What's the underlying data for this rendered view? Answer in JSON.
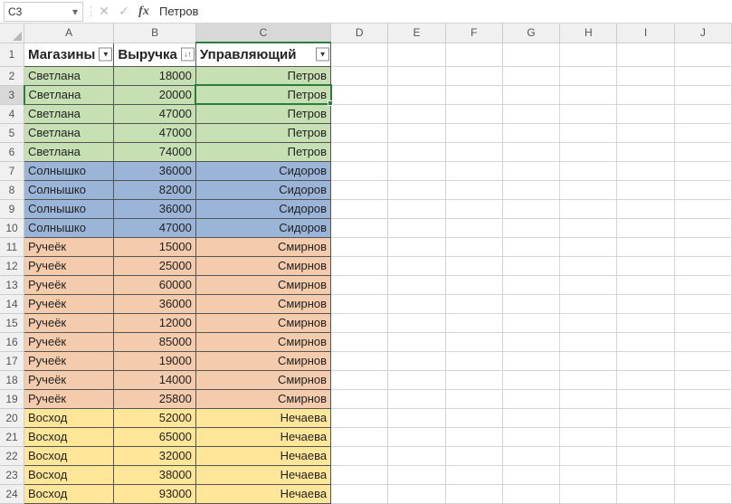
{
  "formula_bar": {
    "cell_ref": "C3",
    "cancel": "✕",
    "confirm": "✓",
    "fx": "fx",
    "value": "Петров"
  },
  "columns": [
    "A",
    "B",
    "C",
    "D",
    "E",
    "F",
    "G",
    "H",
    "I",
    "J"
  ],
  "active_col": "C",
  "active_row": 3,
  "header": {
    "A": "Магазины",
    "B": "Выручка",
    "C": "Управляющий"
  },
  "filter_glyph": {
    "A": "▼",
    "B": "↓↑",
    "C": "▼"
  },
  "rows": [
    {
      "n": 2,
      "store": "Светлана",
      "rev": 18000,
      "mgr": "Петров",
      "cls": "green"
    },
    {
      "n": 3,
      "store": "Светлана",
      "rev": 20000,
      "mgr": "Петров",
      "cls": "green"
    },
    {
      "n": 4,
      "store": "Светлана",
      "rev": 47000,
      "mgr": "Петров",
      "cls": "green"
    },
    {
      "n": 5,
      "store": "Светлана",
      "rev": 47000,
      "mgr": "Петров",
      "cls": "green"
    },
    {
      "n": 6,
      "store": "Светлана",
      "rev": 74000,
      "mgr": "Петров",
      "cls": "green"
    },
    {
      "n": 7,
      "store": "Солнышко",
      "rev": 36000,
      "mgr": "Сидоров",
      "cls": "blue"
    },
    {
      "n": 8,
      "store": "Солнышко",
      "rev": 82000,
      "mgr": "Сидоров",
      "cls": "blue"
    },
    {
      "n": 9,
      "store": "Солнышко",
      "rev": 36000,
      "mgr": "Сидоров",
      "cls": "blue"
    },
    {
      "n": 10,
      "store": "Солнышко",
      "rev": 47000,
      "mgr": "Сидоров",
      "cls": "blue"
    },
    {
      "n": 11,
      "store": "Ручеёк",
      "rev": 15000,
      "mgr": "Смирнов",
      "cls": "peach"
    },
    {
      "n": 12,
      "store": "Ручеёк",
      "rev": 25000,
      "mgr": "Смирнов",
      "cls": "peach"
    },
    {
      "n": 13,
      "store": "Ручеёк",
      "rev": 60000,
      "mgr": "Смирнов",
      "cls": "peach"
    },
    {
      "n": 14,
      "store": "Ручеёк",
      "rev": 36000,
      "mgr": "Смирнов",
      "cls": "peach"
    },
    {
      "n": 15,
      "store": "Ручеёк",
      "rev": 12000,
      "mgr": "Смирнов",
      "cls": "peach"
    },
    {
      "n": 16,
      "store": "Ручеёк",
      "rev": 85000,
      "mgr": "Смирнов",
      "cls": "peach"
    },
    {
      "n": 17,
      "store": "Ручеёк",
      "rev": 19000,
      "mgr": "Смирнов",
      "cls": "peach"
    },
    {
      "n": 18,
      "store": "Ручеёк",
      "rev": 14000,
      "mgr": "Смирнов",
      "cls": "peach"
    },
    {
      "n": 19,
      "store": "Ручеёк",
      "rev": 25800,
      "mgr": "Смирнов",
      "cls": "peach"
    },
    {
      "n": 20,
      "store": "Восход",
      "rev": 52000,
      "mgr": "Нечаева",
      "cls": "yellow"
    },
    {
      "n": 21,
      "store": "Восход",
      "rev": 65000,
      "mgr": "Нечаева",
      "cls": "yellow"
    },
    {
      "n": 22,
      "store": "Восход",
      "rev": 32000,
      "mgr": "Нечаева",
      "cls": "yellow"
    },
    {
      "n": 23,
      "store": "Восход",
      "rev": 38000,
      "mgr": "Нечаева",
      "cls": "yellow"
    },
    {
      "n": 24,
      "store": "Восход",
      "rev": 93000,
      "mgr": "Нечаева",
      "cls": "yellow"
    }
  ],
  "colors": {
    "green": "#c6e0b4",
    "blue": "#9bb5d9",
    "peach": "#f4cbac",
    "yellow": "#ffe699"
  }
}
